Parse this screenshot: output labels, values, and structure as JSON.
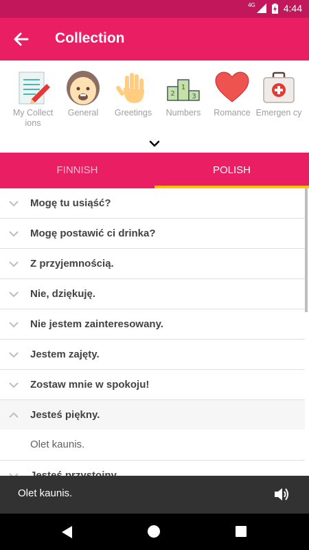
{
  "status": {
    "network": "4G",
    "time": "4:44"
  },
  "appbar": {
    "title": "Collection"
  },
  "categories": [
    {
      "label": "My Collect ions",
      "icon": "notepad-pencil-icon"
    },
    {
      "label": "General",
      "icon": "face-icon"
    },
    {
      "label": "Greetings",
      "icon": "hand-wave-icon"
    },
    {
      "label": "Numbers",
      "icon": "podium-icon"
    },
    {
      "label": "Romance",
      "icon": "heart-icon"
    },
    {
      "label": "Emergen cy",
      "icon": "first-aid-kit-icon"
    }
  ],
  "tabs": [
    {
      "label": "FINNISH"
    },
    {
      "label": "POLISH"
    }
  ],
  "phrases": [
    "Mogę tu usiąść?",
    "Mogę postawić ci drinka?",
    "Z przyjemnością.",
    "Nie, dziękuję.",
    "Nie jestem zainteresowany.",
    "Jestem zajęty.",
    "Zostaw mnie w spokoju!",
    "Jesteś piękny.",
    "Jesteś przystojny."
  ],
  "expanded": {
    "translation": "Olet kaunis."
  },
  "snackbar": {
    "text": "Olet kaunis.",
    "icon": "speaker-icon"
  },
  "colors": {
    "primary": "#e91e63",
    "primary_dark": "#c2185b",
    "accent": "#ffc107"
  }
}
